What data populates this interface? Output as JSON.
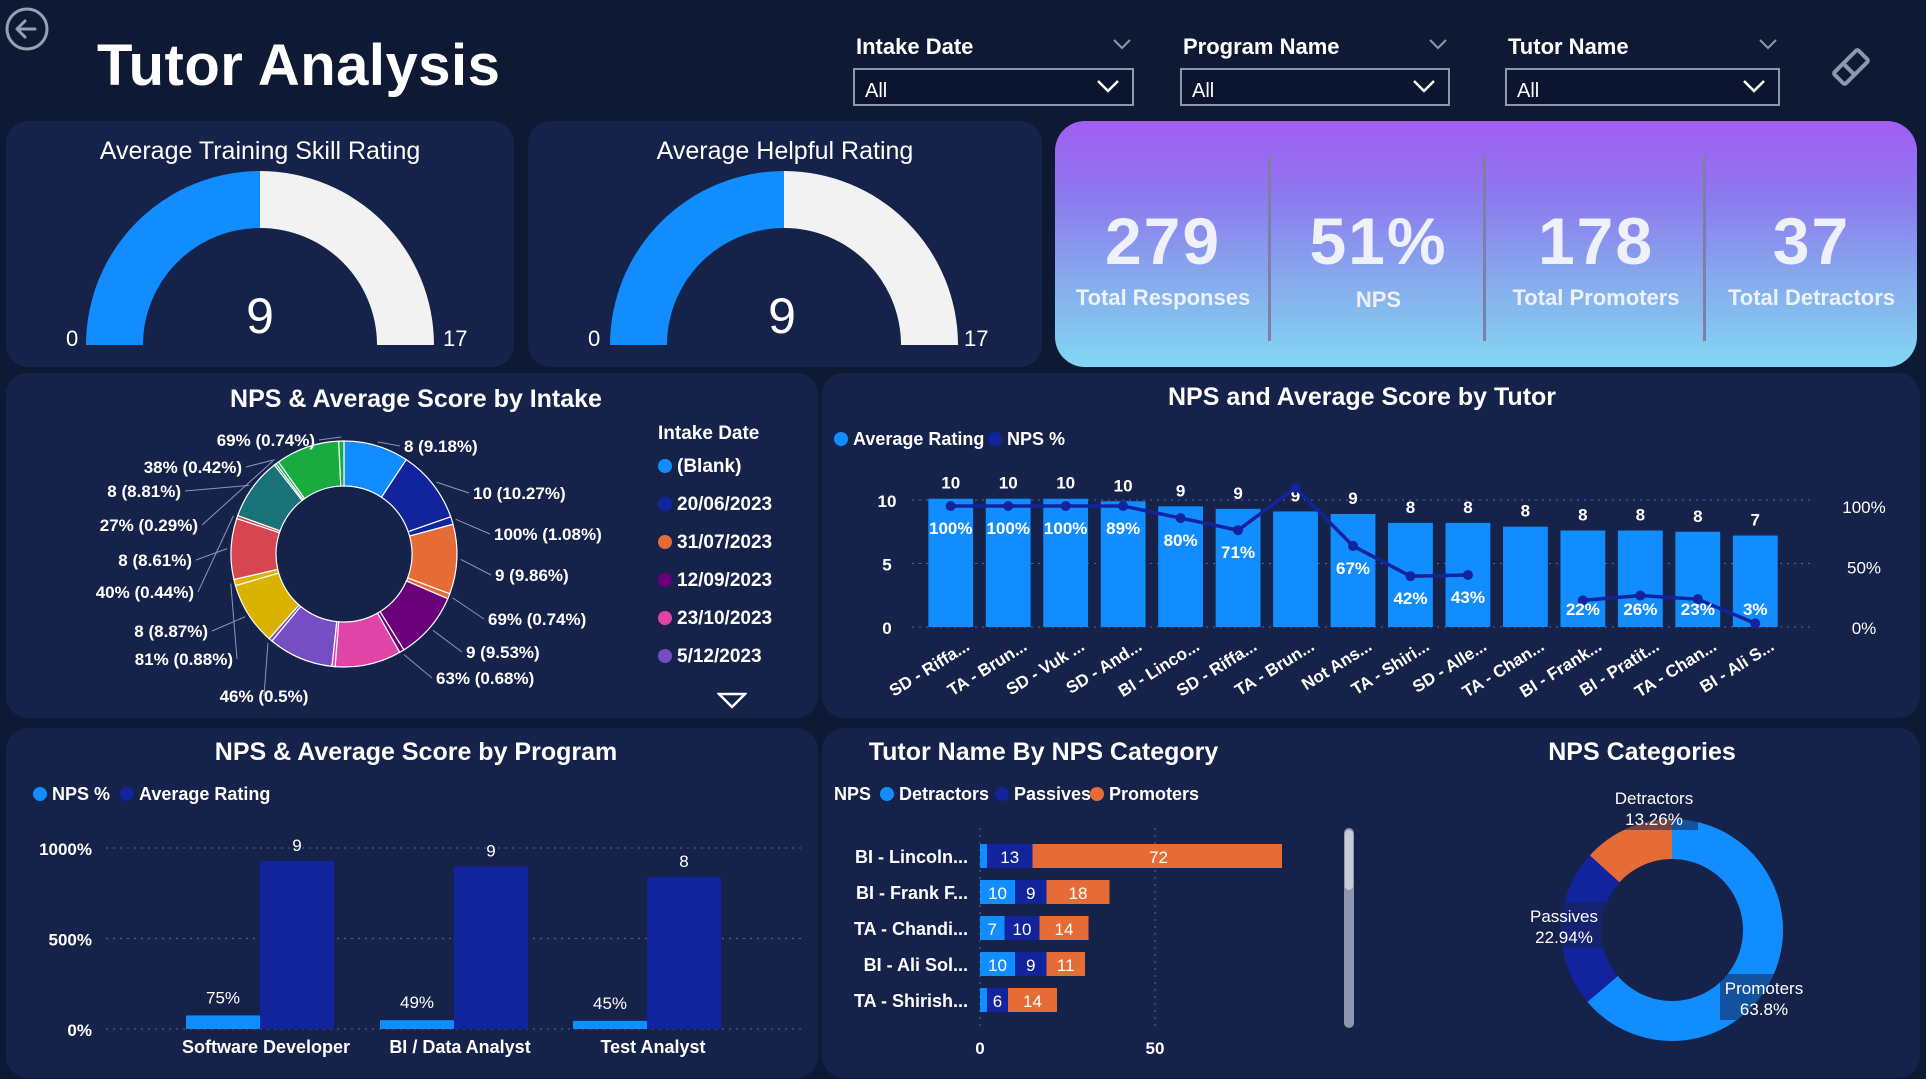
{
  "header": {
    "title": "Tutor Analysis",
    "filters": [
      {
        "label": "Intake Date",
        "value": "All"
      },
      {
        "label": "Program Name",
        "value": "All"
      },
      {
        "label": "Tutor Name",
        "value": "All"
      }
    ]
  },
  "gauges": [
    {
      "title": "Average Training Skill Rating",
      "value": 9,
      "min": 0,
      "max": 17
    },
    {
      "title": "Average Helpful Rating",
      "value": 9,
      "min": 0,
      "max": 17
    }
  ],
  "kpis": [
    {
      "value": "279",
      "label": "Total Responses"
    },
    {
      "value": "51%",
      "label": "NPS"
    },
    {
      "value": "178",
      "label": "Total Promoters"
    },
    {
      "value": "37",
      "label": "Total Detractors"
    }
  ],
  "colors": {
    "background": "#0e1a33",
    "card": "#15224a",
    "bright_blue": "#118dff",
    "dark_blue": "#12239e",
    "orange": "#e66c37",
    "gauge_rest": "#f2f2f2"
  },
  "icons": {
    "back": "back-arrow-icon",
    "eraser": "eraser-icon",
    "chevron": "chevron-down-icon",
    "more": "triangle-down-icon"
  },
  "chart_data": [
    {
      "id": "intake",
      "type": "pie",
      "title": "NPS & Average Score by Intake",
      "legend_title": "Intake Date",
      "legend": [
        {
          "name": "(Blank)",
          "color": "#118dff"
        },
        {
          "name": "20/06/2023",
          "color": "#12239e"
        },
        {
          "name": "31/07/2023",
          "color": "#e66c37"
        },
        {
          "name": "12/09/2023",
          "color": "#6b007b"
        },
        {
          "name": "23/10/2023",
          "color": "#e044a7"
        },
        {
          "name": "5/12/2023",
          "color": "#744ec2"
        }
      ],
      "slices": [
        {
          "label": "8 (9.18%)",
          "value": 9.18,
          "color": "#118dff"
        },
        {
          "label": "10 (10.27%)",
          "value": 10.27,
          "color": "#12239e"
        },
        {
          "label": "100% (1.08%)",
          "value": 1.08,
          "color": "#12239e"
        },
        {
          "label": "9 (9.86%)",
          "value": 9.86,
          "color": "#e66c37"
        },
        {
          "label": "69% (0.74%)",
          "value": 0.74,
          "color": "#e66c37"
        },
        {
          "label": "9 (9.53%)",
          "value": 9.53,
          "color": "#6b007b"
        },
        {
          "label": "63% (0.68%)",
          "value": 0.68,
          "color": "#6b007b"
        },
        {
          "label": "",
          "value": 9.35,
          "color": "#e044a7"
        },
        {
          "label": "",
          "value": 0.45,
          "color": "#e044a7"
        },
        {
          "label": "",
          "value": 9.2,
          "color": "#744ec2"
        },
        {
          "label": "46% (0.5%)",
          "value": 0.5,
          "color": "#744ec2"
        },
        {
          "label": "8 (8.87%)",
          "value": 8.87,
          "color": "#d9b300"
        },
        {
          "label": "81% (0.88%)",
          "value": 0.88,
          "color": "#d9b300"
        },
        {
          "label": "8 (8.61%)",
          "value": 8.61,
          "color": "#d64550"
        },
        {
          "label": "40% (0.44%)",
          "value": 0.44,
          "color": "#d64550"
        },
        {
          "label": "8 (8.81%)",
          "value": 8.81,
          "color": "#197278"
        },
        {
          "label": "27% (0.29%)",
          "value": 0.29,
          "color": "#197278"
        },
        {
          "label": "38% (0.42%)",
          "value": 0.42,
          "color": "#1aab40"
        },
        {
          "label": "",
          "value": 9.0,
          "color": "#1aab40"
        },
        {
          "label": "69% (0.74%)",
          "value": 0.74,
          "color": "#1aab40"
        }
      ]
    },
    {
      "id": "tutor",
      "type": "bar",
      "title": "NPS and Average Score by Tutor",
      "series": [
        {
          "name": "Average Rating",
          "color": "#118dff",
          "values": [
            10,
            10,
            10,
            10,
            9,
            9,
            9,
            9,
            8,
            8,
            8,
            8,
            8,
            8,
            7
          ]
        },
        {
          "name": "NPS %",
          "color": "#12239e",
          "values": [
            "100%",
            "100%",
            "100%",
            "89%",
            "80%",
            "71%",
            null,
            "67%",
            "42%",
            "43%",
            null,
            "22%",
            "26%",
            "23%",
            "3%"
          ]
        }
      ],
      "categories": [
        "SD - Riffa...",
        "TA - Brun...",
        "SD - Vuk ...",
        "SD - And...",
        "BI - Linco...",
        "SD - Riffa...",
        "TA - Brun...",
        "Not Ans...",
        "TA - Shiri...",
        "SD - Alle...",
        "TA - Chan...",
        "BI - Frank...",
        "BI - Pratit...",
        "TA - Chan...",
        "BI - Ali S..."
      ],
      "bar_heights": [
        10.1,
        10.1,
        10.1,
        9.9,
        9.5,
        9.3,
        9.1,
        8.9,
        8.2,
        8.2,
        7.9,
        7.6,
        7.6,
        7.5,
        7.2
      ],
      "line_points": [
        100,
        100,
        100,
        100,
        90,
        80,
        115,
        67,
        42,
        43,
        null,
        22,
        26,
        23,
        3
      ],
      "y_left_ticks": [
        "0",
        "5",
        "10"
      ],
      "y_right_ticks": [
        "0%",
        "50%",
        "100%"
      ],
      "ylim_left": [
        0,
        10.5
      ],
      "ylim_right": [
        0,
        105
      ]
    },
    {
      "id": "program",
      "type": "bar",
      "title": "NPS & Average Score by Program",
      "categories": [
        "Software Developer",
        "BI / Data Analyst",
        "Test Analyst"
      ],
      "series": [
        {
          "name": "NPS %",
          "color": "#118dff",
          "values": [
            75,
            49,
            45
          ],
          "labels": [
            "75%",
            "49%",
            "45%"
          ]
        },
        {
          "name": "Average Rating",
          "color": "#12239e",
          "values": [
            9.4,
            9.1,
            8.5
          ],
          "labels": [
            "9",
            "9",
            "8"
          ]
        }
      ],
      "y_ticks": [
        "0%",
        "500%",
        "1000%"
      ],
      "ylim": [
        0,
        1000
      ]
    },
    {
      "id": "tutor_nps",
      "type": "bar",
      "title": "Tutor Name By NPS Category",
      "legend_title": "NPS",
      "series_names": [
        "Detractors",
        "Passives",
        "Promoters"
      ],
      "series_colors": [
        "#118dff",
        "#12239e",
        "#e66c37"
      ],
      "rows": [
        {
          "name": "BI - Lincoln...",
          "values": [
            2,
            13,
            72
          ],
          "labels": [
            "",
            "13",
            "72"
          ]
        },
        {
          "name": "BI - Frank F...",
          "values": [
            10,
            9,
            18
          ],
          "labels": [
            "10",
            "9",
            "18"
          ]
        },
        {
          "name": "TA - Chandi...",
          "values": [
            7,
            10,
            14
          ],
          "labels": [
            "7",
            "10",
            "14"
          ]
        },
        {
          "name": "BI - Ali Sol...",
          "values": [
            10,
            9,
            11
          ],
          "labels": [
            "10",
            "9",
            "11"
          ]
        },
        {
          "name": "TA - Shirish...",
          "values": [
            2,
            6,
            14
          ],
          "labels": [
            "",
            "6",
            "14"
          ]
        }
      ],
      "x_ticks": [
        "0",
        "50",
        "100"
      ],
      "xlim": [
        0,
        100
      ]
    },
    {
      "id": "nps_categories",
      "type": "pie",
      "title": "NPS Categories",
      "slices": [
        {
          "name": "Promoters",
          "percent": "63.8%",
          "value": 63.8,
          "color": "#118dff"
        },
        {
          "name": "Passives",
          "percent": "22.94%",
          "value": 22.94,
          "color": "#12239e"
        },
        {
          "name": "Detractors",
          "percent": "13.26%",
          "value": 13.26,
          "color": "#e66c37"
        }
      ]
    }
  ]
}
